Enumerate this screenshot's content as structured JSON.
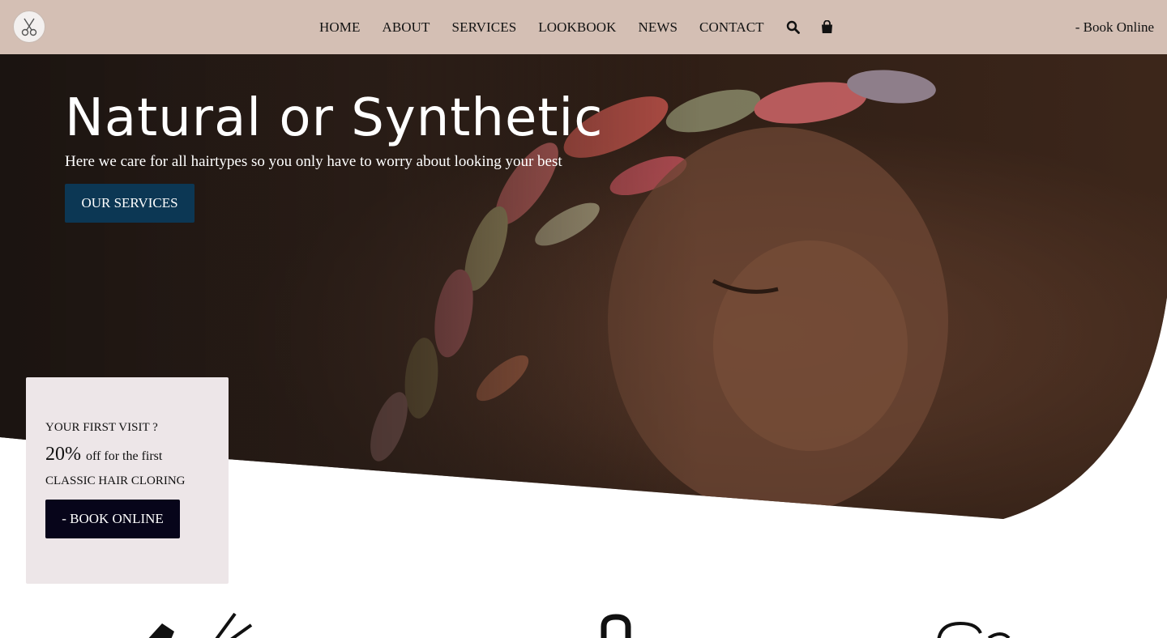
{
  "header": {
    "logo_icon": "scissors-logo-icon",
    "nav": [
      {
        "label": "HOME"
      },
      {
        "label": "ABOUT"
      },
      {
        "label": "SERVICES"
      },
      {
        "label": "LOOKBOOK"
      },
      {
        "label": "NEWS"
      },
      {
        "label": "CONTACT"
      }
    ],
    "search_icon": "search-icon",
    "cart_icon": "shopping-bag-icon",
    "book_online_label": "- Book Online",
    "bg_color": "#d4bfb4"
  },
  "hero": {
    "title": "Natural or Synthetic",
    "subtitle": "Here we care for all hairtypes so you only have to worry about looking your best",
    "button_label": "OUR SERVICES",
    "button_color": "#0c3754"
  },
  "promo": {
    "question": "YOUR FIRST VISIT ?",
    "percent": "20%",
    "percent_text": "off for the first",
    "service": "CLASSIC HAIR CLORING",
    "button_label": "- BOOK ONLINE",
    "bg_color": "#ede6e8",
    "button_color": "#07051a"
  },
  "services_icons": [
    "comb-scissors-icon",
    "hair-dryer-icon",
    "hair-washing-icon"
  ]
}
